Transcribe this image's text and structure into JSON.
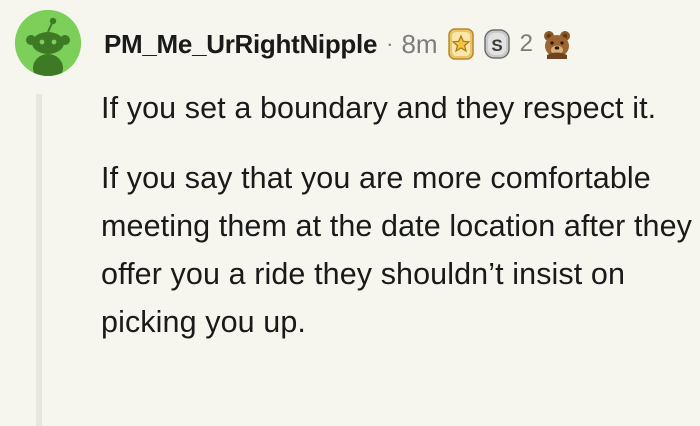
{
  "comment": {
    "username": "PM_Me_UrRightNipple",
    "separator": "·",
    "time": "8m",
    "awards": [
      {
        "icon": "gold-star-award-icon"
      },
      {
        "icon": "silver-s-award-icon",
        "count": "2"
      },
      {
        "icon": "bear-award-icon"
      }
    ],
    "paragraphs": [
      "If you set a boundary and they respect it.",
      "If you say that you are more comfortable meeting them at the date location after they offer you a ride they shouldn’t insist on picking you up."
    ]
  },
  "colors": {
    "background": "#f6f6ef",
    "avatar": "#7ccf58",
    "text": "#1a1a1b",
    "muted": "#7c7c7c"
  }
}
